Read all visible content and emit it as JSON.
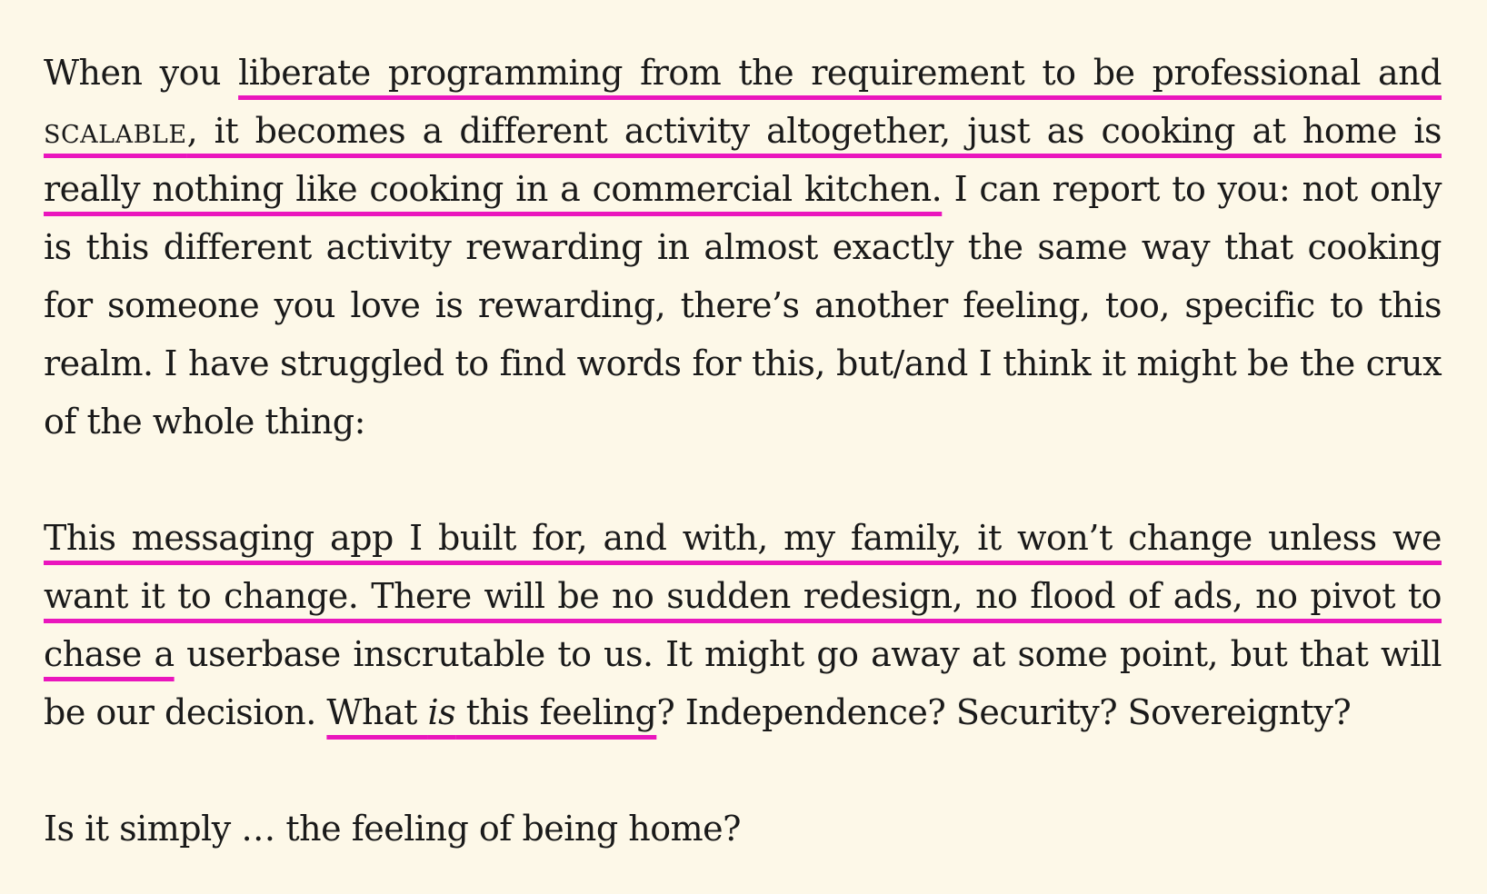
{
  "passage": {
    "p1": {
      "t1": "When you ",
      "h1": "liberate programming from the requirement to be professional and ",
      "h1_sc": "SCALABLE",
      "h1b": ", it becomes a different activity altogether, just as cooking at home is really nothing like cooking in a commercial kitchen.",
      "t2": " I can report to you: not only is this different activity rewarding in almost exactly the same way that cooking for someone you love is rewarding, there’s another feeling, too, specific to this realm. I have struggled to find words for this, but/and I think it might be the crux of the whole thing:"
    },
    "p2": {
      "h1": "This messaging app I built for, and with, my family, it won’t change unless we want it to change. There will be no sudden redesign, no flood of ads, no pivot to chase a",
      "t1": " userbase inscrutable to us. It might go away at some point, but that will be our decision. ",
      "h2a": "What ",
      "h2_em": "is",
      "h2b": " this feeling",
      "t2": "? Independence? Security? Sovereignty?"
    },
    "p3": {
      "t1": "Is it simply … the feeling of being home?"
    }
  },
  "highlight_color": "#ea16bd",
  "background_color": "#fdf8e8"
}
